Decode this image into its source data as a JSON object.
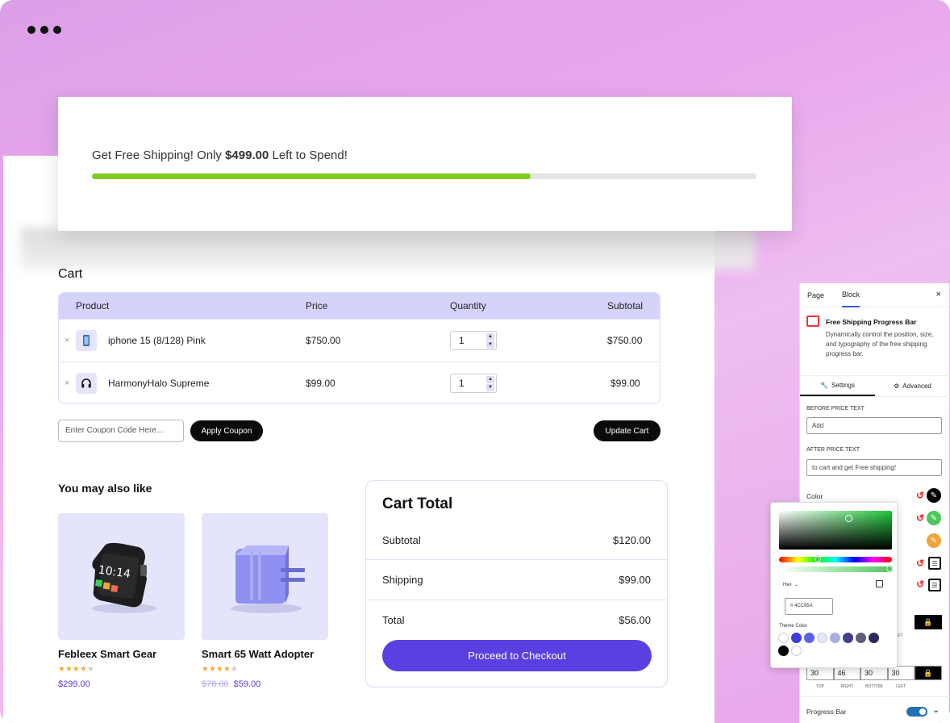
{
  "banner": {
    "msg_before": "Get Free Shipping! Only ",
    "amount": "$499.00",
    "msg_after": " Left to Spend!",
    "progress_fraction": 0.66
  },
  "cart": {
    "title": "Cart",
    "headers": [
      "Product",
      "Price",
      "Quantity",
      "Subtotal"
    ],
    "rows": [
      {
        "name": "iphone 15 (8/128) Pink",
        "price": "$750.00",
        "qty": "1",
        "subtotal": "$750.00",
        "icon": "phone-icon"
      },
      {
        "name": "HarmonyHalo Supreme",
        "price": "$99.00",
        "qty": "1",
        "subtotal": "$99.00",
        "icon": "headphones-icon"
      }
    ],
    "remove": "×",
    "coupon_placeholder": "Enter Coupon Code Here...",
    "apply_label": "Apply Coupon",
    "update_label": "Update Cart"
  },
  "also": {
    "title": "You may also like",
    "products": [
      {
        "name": "Febleex Smart Gear",
        "stars": 4,
        "price": "$299.00",
        "old_price": ""
      },
      {
        "name": "Smart 65 Watt Adopter",
        "stars": 4,
        "price": "$59.00",
        "old_price": "$78.00"
      }
    ]
  },
  "totals": {
    "title": "Cart Total",
    "rows": [
      {
        "label": "Subtotal",
        "value": "$120.00"
      },
      {
        "label": "Shipping",
        "value": "$99.00"
      },
      {
        "label": "Total",
        "value": "$56.00"
      }
    ],
    "checkout_label": "Proceed to Checkout"
  },
  "panel": {
    "tab_page": "Page",
    "tab_block": "Block",
    "close": "×",
    "block_title": "Free Shipping Progress Bar",
    "block_desc": "Dynamically control the position, size, and typography of the free shipping progress bar.",
    "settings_tab": "Settings",
    "advanced_tab": "Advanced",
    "before_label": "BEFORE PRICE TEXT",
    "before_value": "Add",
    "after_label": "AFTER PRICE TEXT",
    "after_value": "to cart and get Free shipping!",
    "color_label": "Color",
    "padding_values": [
      "30",
      "46",
      "30",
      "30"
    ],
    "padding_labels": [
      "TOP",
      "RIGHT",
      "BOTTOM",
      "LEFT"
    ],
    "partial_label": "EFT",
    "progress_label": "Progress Bar"
  },
  "picker": {
    "format": "Hex",
    "hex_value": "4CC95A",
    "theme_label": "Theme Color",
    "swatches": [
      "#ffffff",
      "#3d3ddf",
      "#5a63e8",
      "#e3e6fa",
      "#a9aee0",
      "#3f3f8a",
      "#5d5d7d",
      "#2a2a5c",
      "#000000",
      "#ffffff"
    ]
  },
  "colors": {
    "accent": "#5b3fe0",
    "progress": "#7dcc1f",
    "header_bg": "#d4d4fb"
  }
}
